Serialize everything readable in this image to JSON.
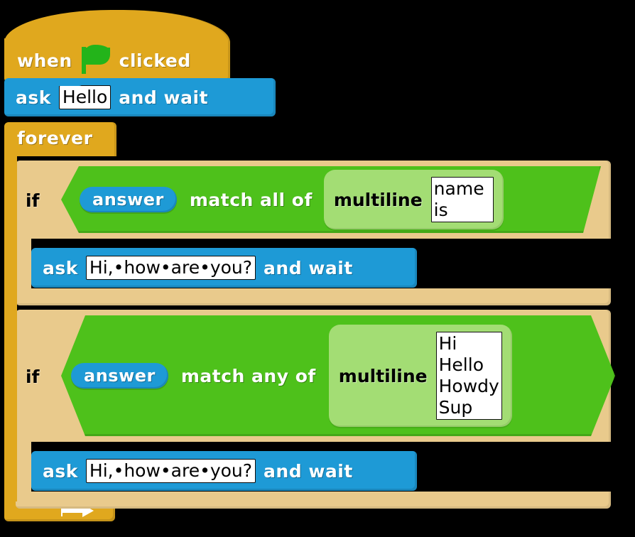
{
  "script": {
    "hat": {
      "text_before": "when",
      "icon": "green-flag-icon",
      "text_after": "clicked",
      "color": "#e0a81e"
    },
    "ask_top": {
      "label_before": "ask",
      "value": "Hello",
      "label_after": "and wait",
      "color": "#1e9ad6"
    },
    "forever": {
      "label": "forever",
      "color": "#e0a81e",
      "loop_icon": "loop-arrow-icon"
    },
    "conditionals": [
      {
        "if_label": "if",
        "operand_reporter": "answer",
        "operator": "match all of",
        "list_label": "multiline",
        "list_value": "name\nis",
        "list_lines": [
          "name",
          "is"
        ],
        "body": {
          "label_before": "ask",
          "value_display": "Hi,•how•are•you?",
          "value": "Hi, how are you?",
          "label_after": "and wait"
        }
      },
      {
        "if_label": "if",
        "operand_reporter": "answer",
        "operator": "match any of",
        "list_label": "multiline",
        "list_value": "Hi\nHello\nHowdy\nSup",
        "list_lines": [
          "Hi",
          "Hello",
          "Howdy",
          "Sup"
        ],
        "body": {
          "label_before": "ask",
          "value_display": "Hi,•how•are•you?",
          "value": "Hi, how are you?",
          "label_after": "and wait"
        }
      }
    ],
    "colors": {
      "control": "#e0a81e",
      "control_inner": "#e9ca8c",
      "sensing": "#1e9ad6",
      "operator_boolean": "#4ec11b",
      "operator_reporter": "#a3dd74",
      "flag_green": "#23b41a",
      "background": "#000000"
    }
  }
}
